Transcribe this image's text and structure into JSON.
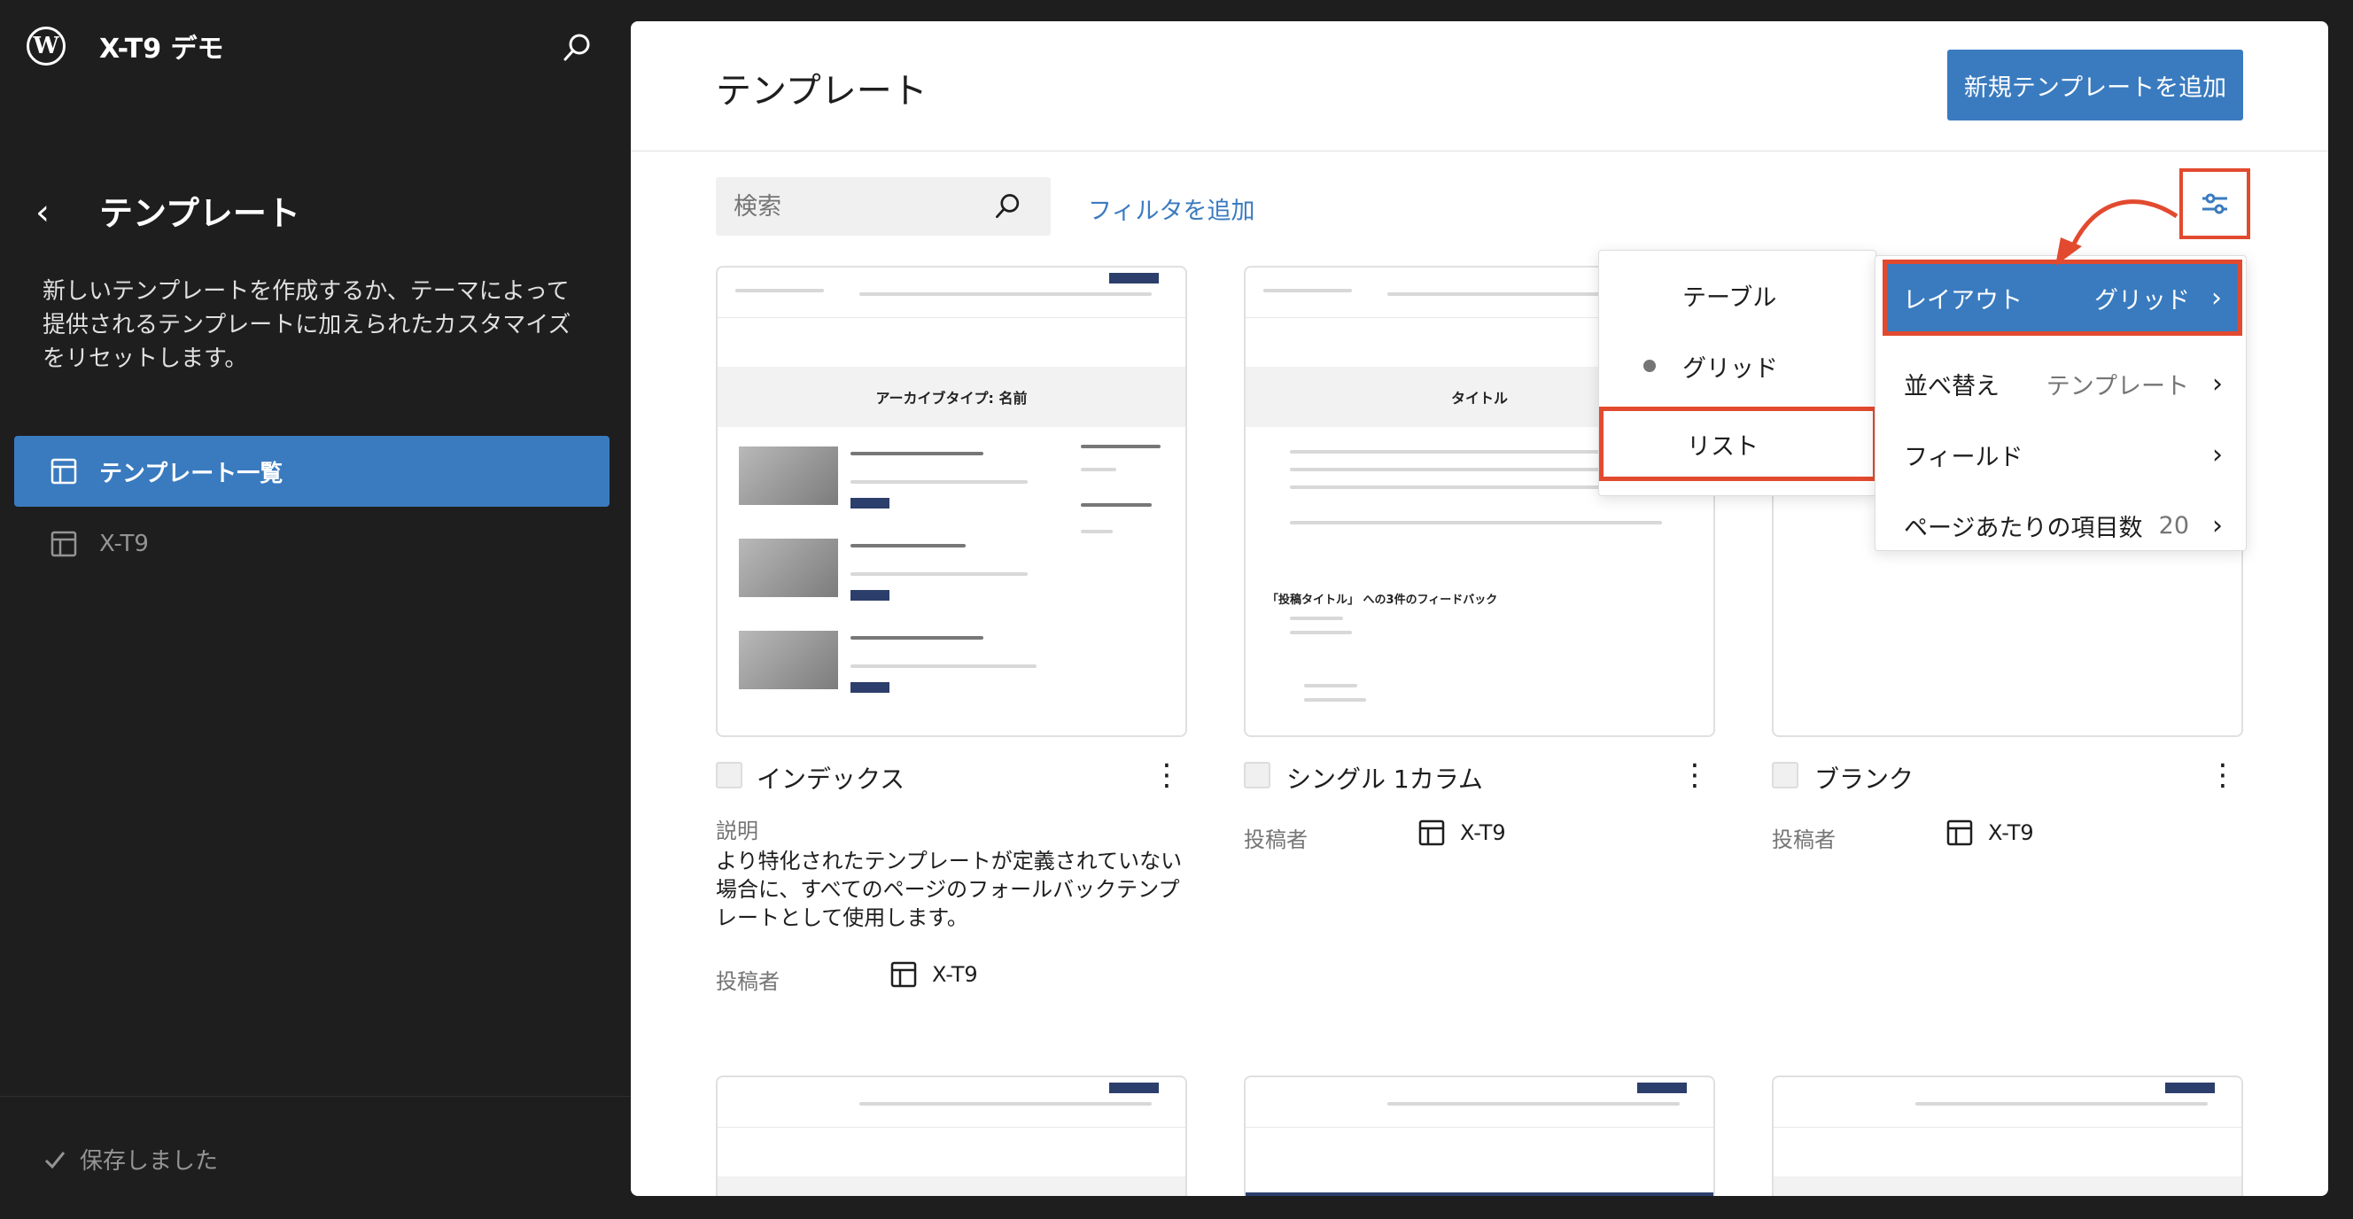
{
  "site": {
    "title": "X-T9 デモ"
  },
  "sidebar": {
    "heading": "テンプレート",
    "description": "新しいテンプレートを作成するか、テーマによって提供されるテンプレートに加えられたカスタマイズをリセットします。",
    "items": [
      {
        "label": "テンプレート一覧",
        "active": true
      },
      {
        "label": "X-T9",
        "active": false
      }
    ],
    "status": "保存しました"
  },
  "main": {
    "title": "テンプレート",
    "add_button": "新規テンプレートを追加",
    "search_placeholder": "検索",
    "filter_link": "フィルタを追加",
    "cards": [
      {
        "title": "インデックス",
        "description_label": "説明",
        "description": "より特化されたテンプレートが定義されていない場合に、すべてのページのフォールバックテンプレートとして使用します。",
        "author_label": "投稿者",
        "author": "X-T9",
        "preview_heading": "アーカイブタイプ: 名前"
      },
      {
        "title": "シングル 1カラム",
        "author_label": "投稿者",
        "author": "X-T9",
        "preview_heading": "タイトル",
        "preview_comments": "「投稿タイトル」 への3件のフィードバック"
      },
      {
        "title": "ブランク",
        "author_label": "投稿者",
        "author": "X-T9"
      }
    ]
  },
  "layout_submenu": {
    "options": [
      "テーブル",
      "グリッド",
      "リスト"
    ],
    "selected": "グリッド"
  },
  "view_menu": {
    "rows": [
      {
        "label": "レイアウト",
        "value": "グリッド"
      },
      {
        "label": "並べ替え",
        "value": "テンプレート"
      },
      {
        "label": "フィールド",
        "value": ""
      },
      {
        "label": "ページあたりの項目数",
        "value": "20"
      }
    ]
  },
  "colors": {
    "accent": "#3a7bbf",
    "highlight": "#e24a2f",
    "sidebar_bg": "#1e1e1e"
  },
  "icons": [
    "wordpress-logo",
    "search-icon",
    "chevron-left-icon",
    "layout-icon",
    "sliders-icon",
    "more-vertical-icon",
    "check-icon",
    "chevron-right-icon"
  ]
}
